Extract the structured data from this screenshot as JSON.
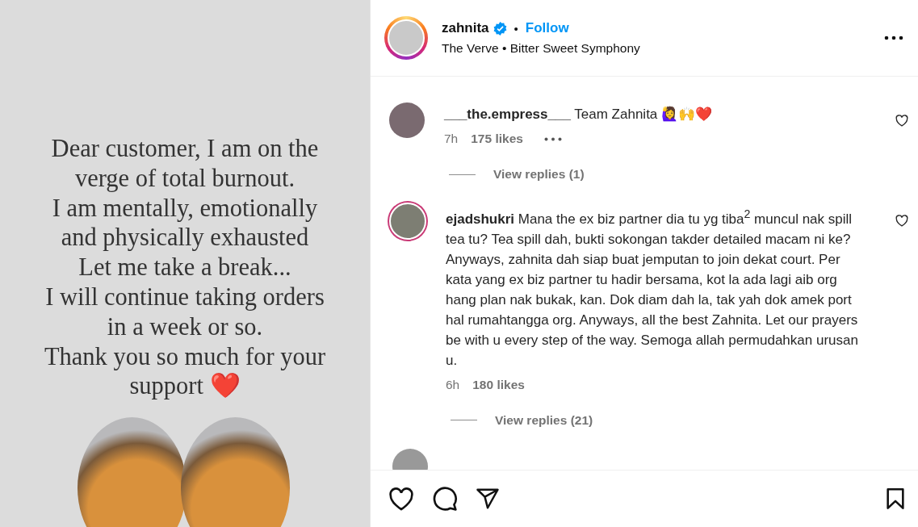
{
  "post_image": {
    "text_lines": [
      "Dear customer, I am on the",
      "verge of total burnout.",
      "I am mentally, emotionally",
      "and physically exhausted",
      "Let me take a break...",
      "I will continue taking orders",
      "in a week or so.",
      "Thank you so much for your",
      "support ❤️"
    ]
  },
  "header": {
    "username": "zahnita",
    "verified": true,
    "separator": "•",
    "follow": "Follow",
    "audio": "The Verve • Bitter Sweet Symphony"
  },
  "comments": [
    {
      "username": "___the.empress___",
      "text": "Team Zahnita 🙋‍♀️🙌❤️",
      "time": "7h",
      "likes": "175 likes",
      "show_more": true,
      "replies": "View replies (1)"
    },
    {
      "username": "ejadshukri",
      "text": "Mana the ex biz partner dia tu yg tiba$^{2}$ muncul nak spill tea tu? Tea spill dah, bukti sokongan takder detailed macam ni ke? Anyways, zahnita dah siap buat jemputan to join dekat court. Per kata yang ex biz partner tu hadir bersama, kot la ada lagi aib org hang plan nak bukak, kan. Dok diam dah la, tak yah dok amek port hal rumahtangga org. Anyways, all the best Zahnita. Let our prayers be with u every step of the way. Semoga allah permudahkan urusan u.",
      "time": "6h",
      "likes": "180 likes",
      "show_more": false,
      "replies": "View replies (21)"
    }
  ]
}
